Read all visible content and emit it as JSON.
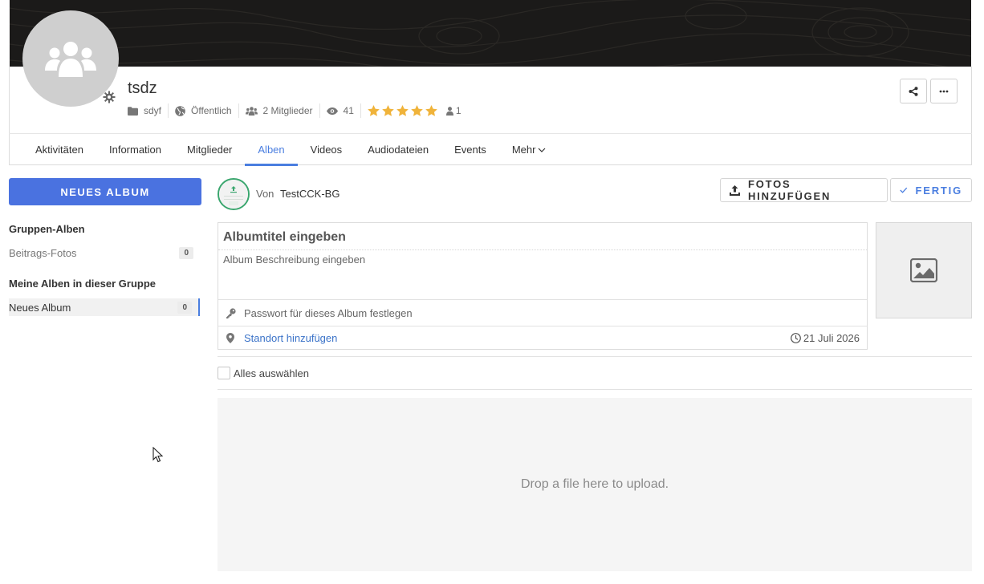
{
  "group": {
    "title": "tsdz",
    "category": "sdyf",
    "visibility": "Öffentlich",
    "members": "2 Mitglieder",
    "views": "41",
    "rating_stars": 5,
    "rating_count": "1"
  },
  "tabs": [
    {
      "label": "Aktivitäten"
    },
    {
      "label": "Information"
    },
    {
      "label": "Mitglieder"
    },
    {
      "label": "Alben",
      "active": true
    },
    {
      "label": "Videos"
    },
    {
      "label": "Audiodateien"
    },
    {
      "label": "Events"
    },
    {
      "label": "Mehr"
    }
  ],
  "sidebar": {
    "new_album_label": "NEUES ALBUM",
    "group_albums_heading": "Gruppen-Alben",
    "group_albums": [
      {
        "label": "Beitrags-Fotos",
        "count": "0"
      }
    ],
    "my_albums_heading": "Meine Alben in dieser Gruppe",
    "my_albums": [
      {
        "label": "Neues Album",
        "count": "0",
        "active": true
      }
    ]
  },
  "author": {
    "prefix": "Von",
    "name": "TestCCK-BG"
  },
  "actions": {
    "add_photos_label": "FOTOS HINZUFÜGEN",
    "done_label": "FERTIG"
  },
  "album_form": {
    "title_placeholder": "Albumtitel eingeben",
    "description_placeholder": "Album Beschreibung eingeben",
    "password_label": "Passwort für dieses Album festlegen",
    "location_label": "Standort hinzufügen",
    "date": "21 Juli 2026"
  },
  "select_all_label": "Alles auswählen",
  "dropzone_text": "Drop a file here to upload.",
  "colors": {
    "accent": "#4a7ee0",
    "primary_button": "#4a72e0",
    "star": "#f0b33a",
    "link": "#3b73c8",
    "author_ring": "#3aa66e"
  }
}
